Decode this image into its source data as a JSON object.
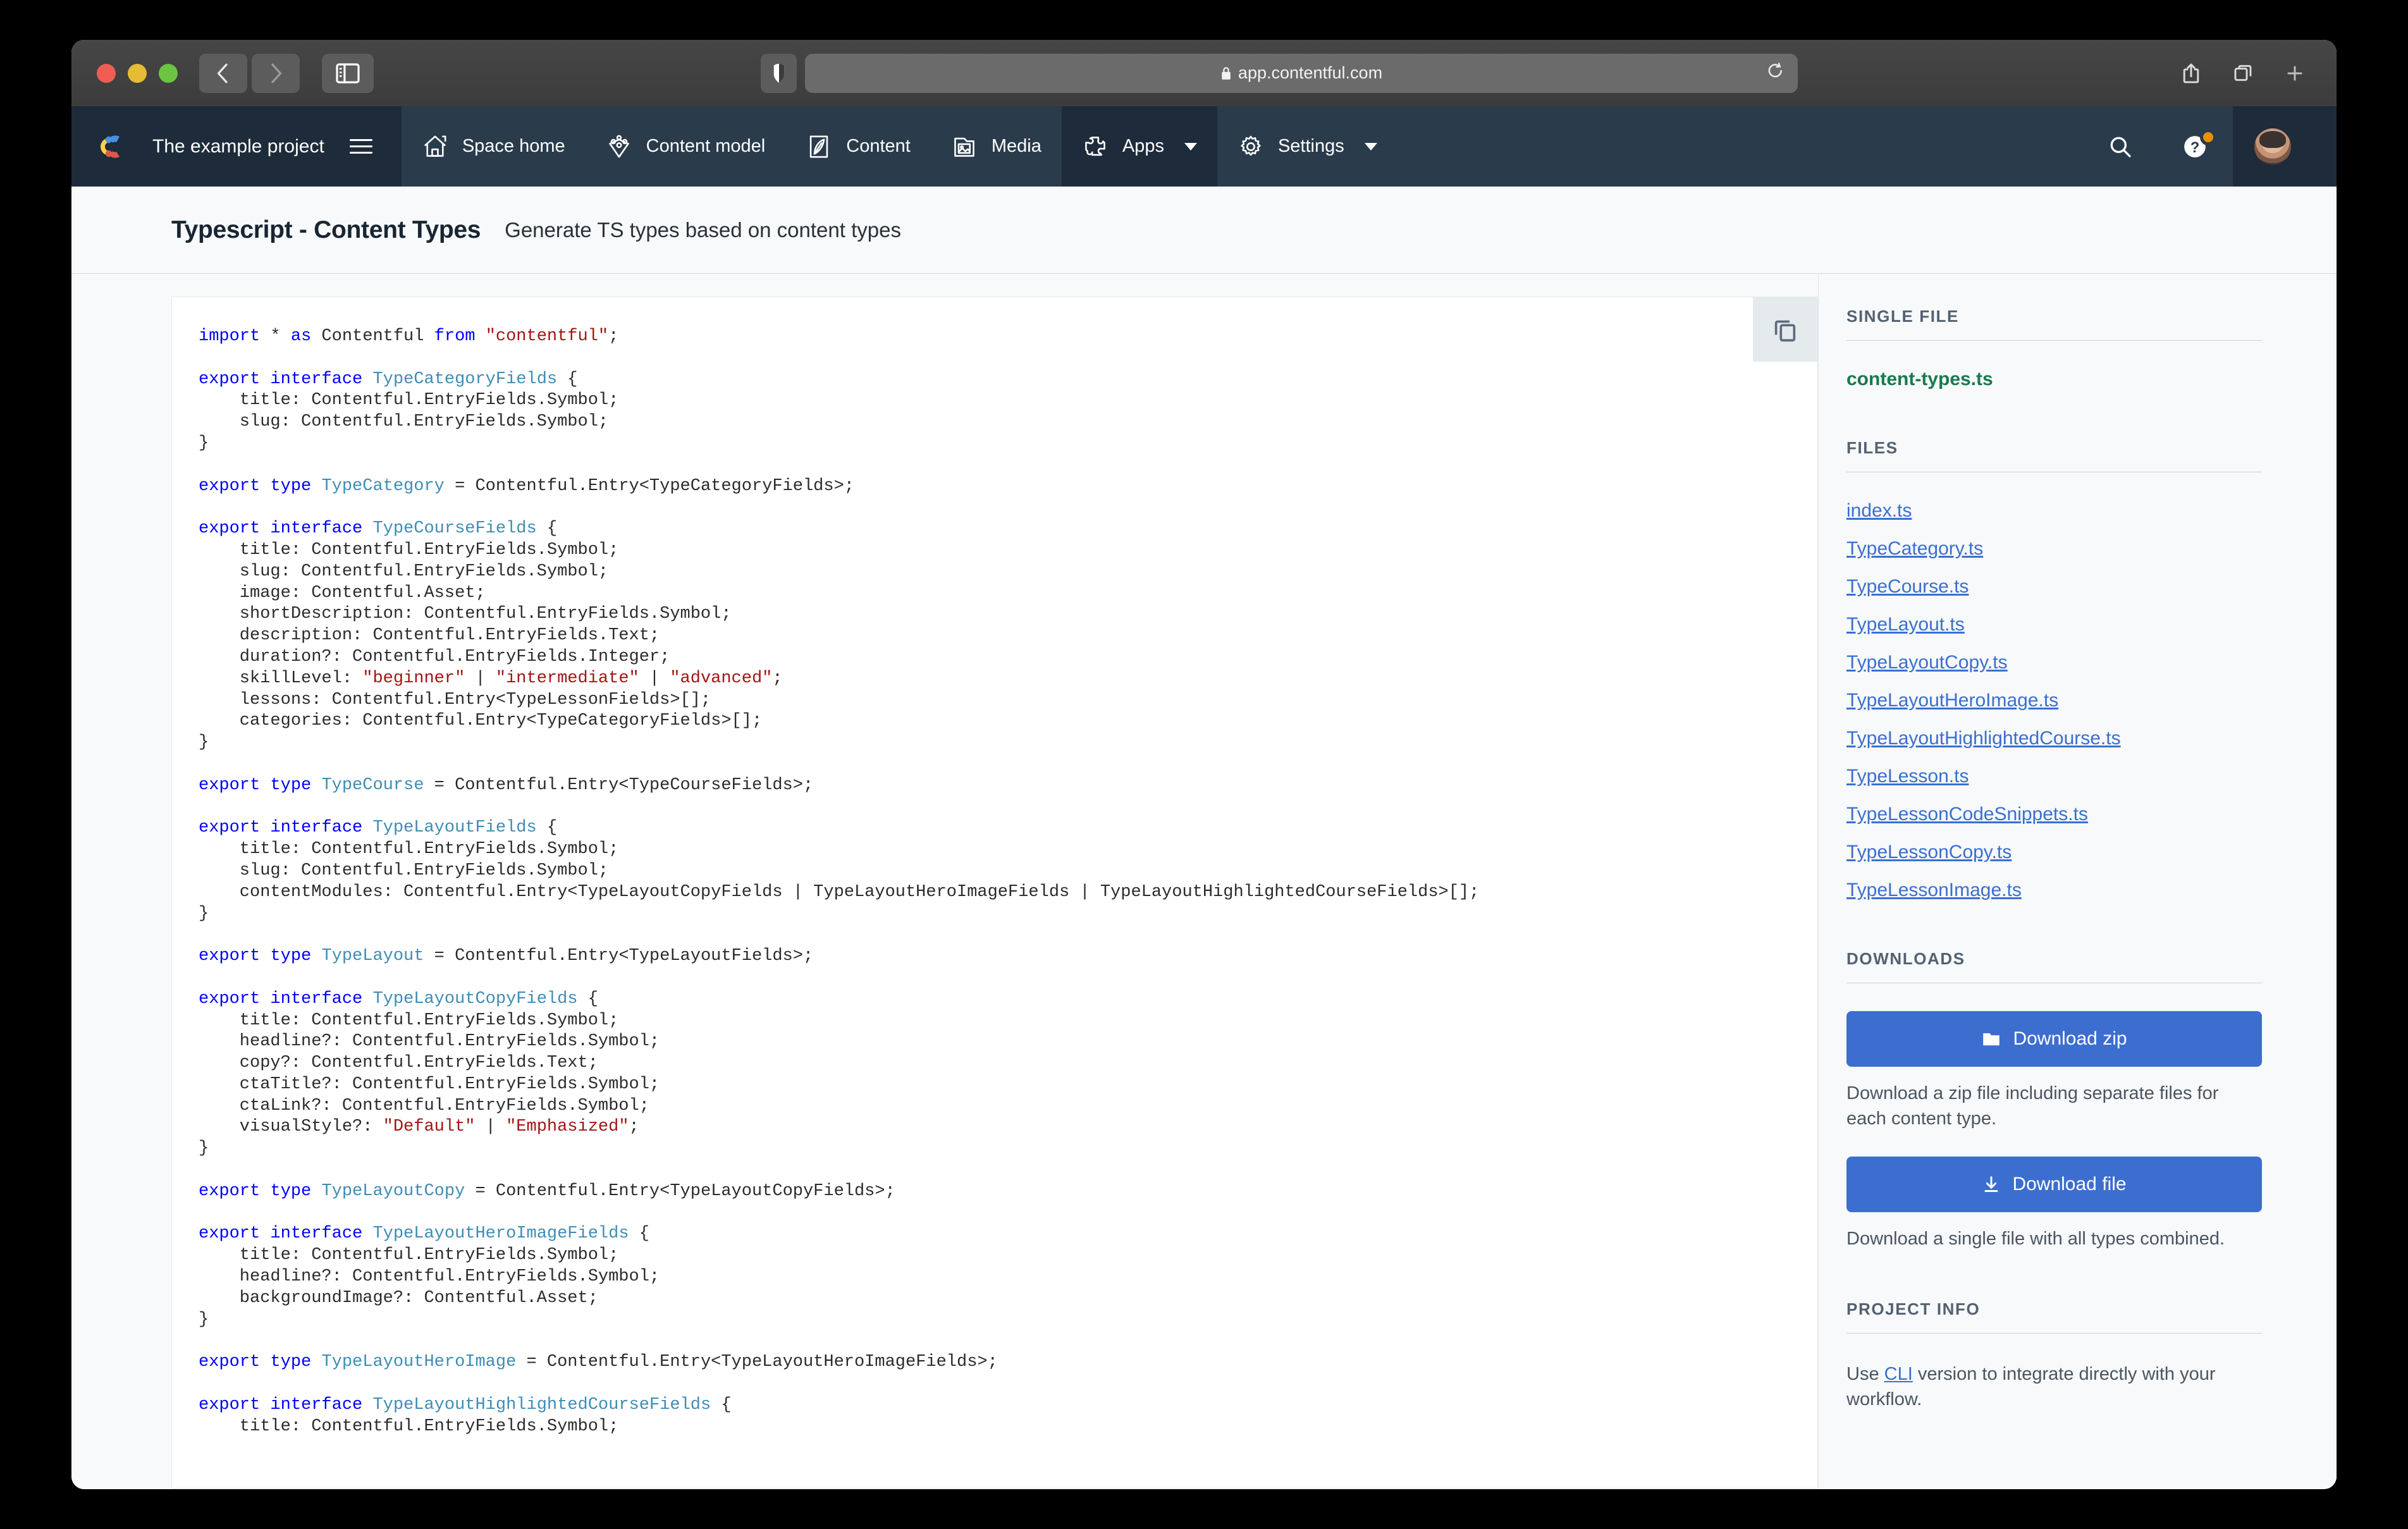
{
  "browser": {
    "url": "app.contentful.com",
    "lock_icon": "lock-icon",
    "back_icon": "chevron-left-icon",
    "forward_icon": "chevron-right-icon",
    "sidebar_toggle_icon": "sidebar-toggle-icon",
    "shield_icon": "shield-icon",
    "reload_icon": "reload-icon",
    "share_icon": "share-icon",
    "tabs_icon": "tabs-overview-icon",
    "newtab_icon": "new-tab-icon"
  },
  "topnav": {
    "brand": "The example project",
    "brand_logo_icon": "contentful-logo-icon",
    "menu_icon": "hamburger-menu-icon",
    "items": [
      {
        "label": "Space home",
        "icon": "home-icon",
        "active": false,
        "caret": false
      },
      {
        "label": "Content model",
        "icon": "content-model-icon",
        "active": false,
        "caret": false
      },
      {
        "label": "Content",
        "icon": "content-quill-icon",
        "active": false,
        "caret": false
      },
      {
        "label": "Media",
        "icon": "media-image-icon",
        "active": false,
        "caret": false
      },
      {
        "label": "Apps",
        "icon": "puzzle-piece-icon",
        "active": true,
        "caret": true
      },
      {
        "label": "Settings",
        "icon": "gear-icon",
        "active": false,
        "caret": true
      }
    ],
    "search_icon": "search-icon",
    "help_icon": "help-question-icon",
    "help_badge_color": "#eb9100",
    "avatar_icon": "user-avatar",
    "avatar_caret_icon": "chevron-down-icon"
  },
  "page": {
    "title": "Typescript - Content Types",
    "subtitle": "Generate TS types based on content types"
  },
  "editor": {
    "copy_icon": "copy-icon",
    "lines": [
      [
        [
          "k",
          "import"
        ],
        [
          "p",
          " * "
        ],
        [
          "k",
          "as"
        ],
        [
          "p",
          " Contentful "
        ],
        [
          "k",
          "from"
        ],
        [
          "p",
          " "
        ],
        [
          "s",
          "\"contentful\""
        ],
        [
          "p",
          ";"
        ]
      ],
      [],
      [
        [
          "k",
          "export interface"
        ],
        [
          "p",
          " "
        ],
        [
          "t",
          "TypeCategoryFields"
        ],
        [
          "p",
          " {"
        ]
      ],
      [
        [
          "p",
          "    title: Contentful.EntryFields.Symbol;"
        ]
      ],
      [
        [
          "p",
          "    slug: Contentful.EntryFields.Symbol;"
        ]
      ],
      [
        [
          "p",
          "}"
        ]
      ],
      [],
      [
        [
          "k",
          "export type"
        ],
        [
          "p",
          " "
        ],
        [
          "t",
          "TypeCategory"
        ],
        [
          "p",
          " = Contentful.Entry<TypeCategoryFields>;"
        ]
      ],
      [],
      [
        [
          "k",
          "export interface"
        ],
        [
          "p",
          " "
        ],
        [
          "t",
          "TypeCourseFields"
        ],
        [
          "p",
          " {"
        ]
      ],
      [
        [
          "p",
          "    title: Contentful.EntryFields.Symbol;"
        ]
      ],
      [
        [
          "p",
          "    slug: Contentful.EntryFields.Symbol;"
        ]
      ],
      [
        [
          "p",
          "    image: Contentful.Asset;"
        ]
      ],
      [
        [
          "p",
          "    shortDescription: Contentful.EntryFields.Symbol;"
        ]
      ],
      [
        [
          "p",
          "    description: Contentful.EntryFields.Text;"
        ]
      ],
      [
        [
          "p",
          "    duration?: Contentful.EntryFields.Integer;"
        ]
      ],
      [
        [
          "p",
          "    skillLevel: "
        ],
        [
          "s",
          "\"beginner\""
        ],
        [
          "p",
          " | "
        ],
        [
          "s",
          "\"intermediate\""
        ],
        [
          "p",
          " | "
        ],
        [
          "s",
          "\"advanced\""
        ],
        [
          "p",
          ";"
        ]
      ],
      [
        [
          "p",
          "    lessons: Contentful.Entry<TypeLessonFields>[];"
        ]
      ],
      [
        [
          "p",
          "    categories: Contentful.Entry<TypeCategoryFields>[];"
        ]
      ],
      [
        [
          "p",
          "}"
        ]
      ],
      [],
      [
        [
          "k",
          "export type"
        ],
        [
          "p",
          " "
        ],
        [
          "t",
          "TypeCourse"
        ],
        [
          "p",
          " = Contentful.Entry<TypeCourseFields>;"
        ]
      ],
      [],
      [
        [
          "k",
          "export interface"
        ],
        [
          "p",
          " "
        ],
        [
          "t",
          "TypeLayoutFields"
        ],
        [
          "p",
          " {"
        ]
      ],
      [
        [
          "p",
          "    title: Contentful.EntryFields.Symbol;"
        ]
      ],
      [
        [
          "p",
          "    slug: Contentful.EntryFields.Symbol;"
        ]
      ],
      [
        [
          "p",
          "    contentModules: Contentful.Entry<TypeLayoutCopyFields | TypeLayoutHeroImageFields | TypeLayoutHighlightedCourseFields>[];"
        ]
      ],
      [
        [
          "p",
          "}"
        ]
      ],
      [],
      [
        [
          "k",
          "export type"
        ],
        [
          "p",
          " "
        ],
        [
          "t",
          "TypeLayout"
        ],
        [
          "p",
          " = Contentful.Entry<TypeLayoutFields>;"
        ]
      ],
      [],
      [
        [
          "k",
          "export interface"
        ],
        [
          "p",
          " "
        ],
        [
          "t",
          "TypeLayoutCopyFields"
        ],
        [
          "p",
          " {"
        ]
      ],
      [
        [
          "p",
          "    title: Contentful.EntryFields.Symbol;"
        ]
      ],
      [
        [
          "p",
          "    headline?: Contentful.EntryFields.Symbol;"
        ]
      ],
      [
        [
          "p",
          "    copy?: Contentful.EntryFields.Text;"
        ]
      ],
      [
        [
          "p",
          "    ctaTitle?: Contentful.EntryFields.Symbol;"
        ]
      ],
      [
        [
          "p",
          "    ctaLink?: Contentful.EntryFields.Symbol;"
        ]
      ],
      [
        [
          "p",
          "    visualStyle?: "
        ],
        [
          "s",
          "\"Default\""
        ],
        [
          "p",
          " | "
        ],
        [
          "s",
          "\"Emphasized\""
        ],
        [
          "p",
          ";"
        ]
      ],
      [
        [
          "p",
          "}"
        ]
      ],
      [],
      [
        [
          "k",
          "export type"
        ],
        [
          "p",
          " "
        ],
        [
          "t",
          "TypeLayoutCopy"
        ],
        [
          "p",
          " = Contentful.Entry<TypeLayoutCopyFields>;"
        ]
      ],
      [],
      [
        [
          "k",
          "export interface"
        ],
        [
          "p",
          " "
        ],
        [
          "t",
          "TypeLayoutHeroImageFields"
        ],
        [
          "p",
          " {"
        ]
      ],
      [
        [
          "p",
          "    title: Contentful.EntryFields.Symbol;"
        ]
      ],
      [
        [
          "p",
          "    headline?: Contentful.EntryFields.Symbol;"
        ]
      ],
      [
        [
          "p",
          "    backgroundImage?: Contentful.Asset;"
        ]
      ],
      [
        [
          "p",
          "}"
        ]
      ],
      [],
      [
        [
          "k",
          "export type"
        ],
        [
          "p",
          " "
        ],
        [
          "t",
          "TypeLayoutHeroImage"
        ],
        [
          "p",
          " = Contentful.Entry<TypeLayoutHeroImageFields>;"
        ]
      ],
      [],
      [
        [
          "k",
          "export interface"
        ],
        [
          "p",
          " "
        ],
        [
          "t",
          "TypeLayoutHighlightedCourseFields"
        ],
        [
          "p",
          " {"
        ]
      ],
      [
        [
          "p",
          "    title: Contentful.EntryFields.Symbol;"
        ]
      ]
    ]
  },
  "sidebar": {
    "single_file_heading": "Single file",
    "single_file_name": "content-types.ts",
    "files_heading": "Files",
    "files": [
      "index.ts",
      "TypeCategory.ts",
      "TypeCourse.ts",
      "TypeLayout.ts",
      "TypeLayoutCopy.ts",
      "TypeLayoutHeroImage.ts",
      "TypeLayoutHighlightedCourse.ts",
      "TypeLesson.ts",
      "TypeLessonCodeSnippets.ts",
      "TypeLessonCopy.ts",
      "TypeLessonImage.ts"
    ],
    "downloads_heading": "Downloads",
    "download_zip_label": "Download zip",
    "download_zip_icon": "folder-icon",
    "download_zip_desc": "Download a zip file including separate files for each content type.",
    "download_file_label": "Download file",
    "download_file_icon": "download-arrow-icon",
    "download_file_desc": "Download a single file with all types combined.",
    "project_info_heading": "Project info",
    "project_info_prefix": "Use ",
    "project_info_link": "CLI",
    "project_info_suffix": " version to integrate directly with your workflow.",
    "accent_color": "#3c6ed0",
    "active_file_color": "#187a4e"
  }
}
